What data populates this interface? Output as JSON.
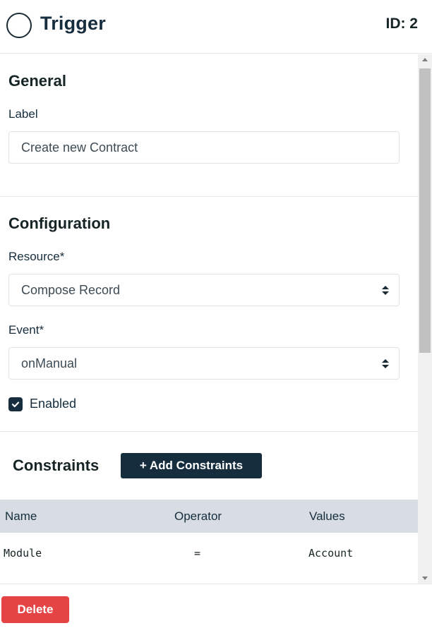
{
  "header": {
    "title": "Trigger",
    "id_text": "ID: 2"
  },
  "general": {
    "heading": "General",
    "label_label": "Label",
    "label_value": "Create new Contract"
  },
  "configuration": {
    "heading": "Configuration",
    "resource_label": "Resource*",
    "resource_value": "Compose Record",
    "event_label": "Event*",
    "event_value": "onManual",
    "enabled_label": "Enabled",
    "enabled_checked": true
  },
  "constraints": {
    "heading": "Constraints",
    "add_button": "+ Add Constraints",
    "columns": [
      "Name",
      "Operator",
      "Values"
    ],
    "rows": [
      {
        "name": "Module",
        "operator": "=",
        "values": "Account"
      }
    ]
  },
  "footer": {
    "delete_button": "Delete"
  },
  "colors": {
    "primary": "#162d3d",
    "danger": "#e54444",
    "table_header": "#d7dde2"
  }
}
